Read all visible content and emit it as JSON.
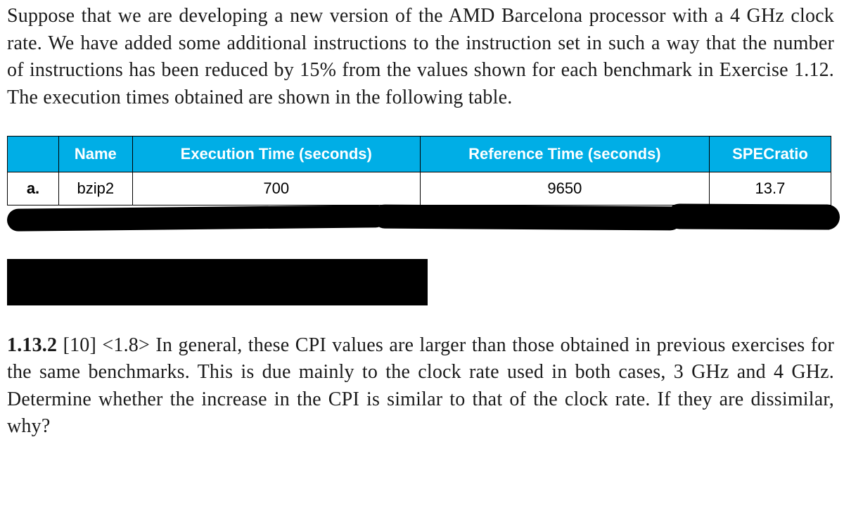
{
  "intro": "Suppose that we are developing a new version of the AMD Barcelona processor with a 4 GHz clock rate. We have added some additional instructions to the instruction set in such a way that the number of instructions has been reduced by 15% from the values shown for each benchmark in Exercise 1.12. The execution times obtained are shown in the following table.",
  "table": {
    "headers": {
      "name": "Name",
      "exec": "Execution Time (seconds)",
      "ref": "Reference Time (seconds)",
      "spec": "SPECratio"
    },
    "rows": [
      {
        "label": "a.",
        "name": "bzip2",
        "exec": "700",
        "ref": "9650",
        "spec": "13.7"
      }
    ]
  },
  "question": {
    "number": "1.13.2",
    "meta": "[10] <1.8>",
    "text": "In general, these CPI values are larger than those obtained in previous exercises for the same benchmarks. This is due mainly to the clock rate used in both cases, 3 GHz and 4 GHz. Determine whether the increase in the CPI is similar to that of the clock rate. If they are dissimilar, why?"
  }
}
